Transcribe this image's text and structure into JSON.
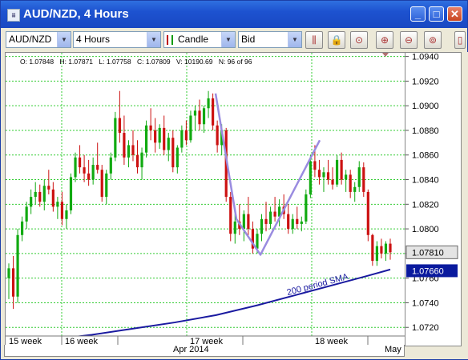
{
  "window": {
    "title": "AUD/NZD,  4 Hours",
    "minimize": "_",
    "maximize": "□",
    "close": "✕"
  },
  "toolbar": {
    "symbol": "AUD/NZD",
    "timeframe": "4 Hours",
    "chart_type": "Candle",
    "price_type": "Bid",
    "icons": [
      "bars-icon",
      "lock-icon",
      "zoom-fit-icon",
      "zoom-in-icon",
      "zoom-out-icon",
      "zoom-reset-icon"
    ]
  },
  "ohlc": {
    "open": "O: 1.07848",
    "high": "H: 1.07871",
    "low": "L: 1.07758",
    "close": "C: 1.07809",
    "volume": "V: 10190.69",
    "count": "N: 96 of 96"
  },
  "price_axis": {
    "labels": [
      "1.0940",
      "1.0920",
      "1.0900",
      "1.0880",
      "1.0860",
      "1.0840",
      "1.0820",
      "1.0800",
      "1.0780",
      "1.0760",
      "1.0740",
      "1.0720"
    ],
    "current_price": "1.07810",
    "sma_price": "1.07660"
  },
  "time_axis": {
    "weeks": [
      "15 week",
      "16 week",
      "17 week",
      "18 week"
    ],
    "months": [
      "Apr 2014",
      "May"
    ]
  },
  "annotations": {
    "sma_label": "200 period SMA"
  },
  "colors": {
    "bull": "#11aa11",
    "bear": "#cc1111",
    "grid": "#33cc33",
    "sma": "#1a1aa0",
    "pattern": "#9a8ce0",
    "sma_box": "#0a1a9e"
  },
  "chart_data": {
    "type": "candlestick",
    "title": "AUD/NZD,  4 Hours",
    "ylim": [
      1.0713,
      1.0943
    ],
    "annotation": "200 period SMA",
    "candles": [
      {
        "o": 1.076,
        "h": 1.0772,
        "l": 1.0743,
        "c": 1.0768
      },
      {
        "o": 1.0768,
        "h": 1.0778,
        "l": 1.0735,
        "c": 1.0745
      },
      {
        "o": 1.0745,
        "h": 1.08,
        "l": 1.074,
        "c": 1.0795
      },
      {
        "o": 1.0795,
        "h": 1.081,
        "l": 1.079,
        "c": 1.0806
      },
      {
        "o": 1.0806,
        "h": 1.0822,
        "l": 1.08,
        "c": 1.0818
      },
      {
        "o": 1.0818,
        "h": 1.0832,
        "l": 1.0812,
        "c": 1.0826
      },
      {
        "o": 1.0826,
        "h": 1.0838,
        "l": 1.082,
        "c": 1.083
      },
      {
        "o": 1.083,
        "h": 1.0836,
        "l": 1.0818,
        "c": 1.0822
      },
      {
        "o": 1.0822,
        "h": 1.084,
        "l": 1.0815,
        "c": 1.0835
      },
      {
        "o": 1.0835,
        "h": 1.0848,
        "l": 1.0828,
        "c": 1.0832
      },
      {
        "o": 1.0832,
        "h": 1.0838,
        "l": 1.0814,
        "c": 1.0818
      },
      {
        "o": 1.0818,
        "h": 1.0826,
        "l": 1.0808,
        "c": 1.0822
      },
      {
        "o": 1.0822,
        "h": 1.083,
        "l": 1.0803,
        "c": 1.0808
      },
      {
        "o": 1.0808,
        "h": 1.082,
        "l": 1.08,
        "c": 1.0815
      },
      {
        "o": 1.0815,
        "h": 1.0845,
        "l": 1.0812,
        "c": 1.0842
      },
      {
        "o": 1.0842,
        "h": 1.0862,
        "l": 1.0838,
        "c": 1.0858
      },
      {
        "o": 1.0858,
        "h": 1.0868,
        "l": 1.0845,
        "c": 1.085
      },
      {
        "o": 1.085,
        "h": 1.086,
        "l": 1.0838,
        "c": 1.0845
      },
      {
        "o": 1.0845,
        "h": 1.0856,
        "l": 1.0835,
        "c": 1.084
      },
      {
        "o": 1.084,
        "h": 1.0858,
        "l": 1.0836,
        "c": 1.0852
      },
      {
        "o": 1.0852,
        "h": 1.087,
        "l": 1.0845,
        "c": 1.0848
      },
      {
        "o": 1.0848,
        "h": 1.0852,
        "l": 1.0822,
        "c": 1.0826
      },
      {
        "o": 1.0826,
        "h": 1.0848,
        "l": 1.082,
        "c": 1.0845
      },
      {
        "o": 1.0845,
        "h": 1.0862,
        "l": 1.084,
        "c": 1.0858
      },
      {
        "o": 1.0858,
        "h": 1.0895,
        "l": 1.0855,
        "c": 1.089
      },
      {
        "o": 1.089,
        "h": 1.0912,
        "l": 1.087,
        "c": 1.0878
      },
      {
        "o": 1.0878,
        "h": 1.0892,
        "l": 1.0852,
        "c": 1.0858
      },
      {
        "o": 1.0858,
        "h": 1.0872,
        "l": 1.085,
        "c": 1.0868
      },
      {
        "o": 1.0868,
        "h": 1.088,
        "l": 1.0855,
        "c": 1.086
      },
      {
        "o": 1.086,
        "h": 1.0872,
        "l": 1.0845,
        "c": 1.085
      },
      {
        "o": 1.085,
        "h": 1.0866,
        "l": 1.084,
        "c": 1.0862
      },
      {
        "o": 1.0862,
        "h": 1.0888,
        "l": 1.0858,
        "c": 1.0884
      },
      {
        "o": 1.0884,
        "h": 1.0898,
        "l": 1.0872,
        "c": 1.088
      },
      {
        "o": 1.088,
        "h": 1.089,
        "l": 1.0862,
        "c": 1.087
      },
      {
        "o": 1.087,
        "h": 1.0885,
        "l": 1.0865,
        "c": 1.0882
      },
      {
        "o": 1.0882,
        "h": 1.0892,
        "l": 1.086,
        "c": 1.0864
      },
      {
        "o": 1.0864,
        "h": 1.0878,
        "l": 1.0855,
        "c": 1.0874
      },
      {
        "o": 1.0874,
        "h": 1.088,
        "l": 1.0846,
        "c": 1.085
      },
      {
        "o": 1.085,
        "h": 1.0868,
        "l": 1.0845,
        "c": 1.0866
      },
      {
        "o": 1.0866,
        "h": 1.0884,
        "l": 1.0862,
        "c": 1.088
      },
      {
        "o": 1.088,
        "h": 1.0888,
        "l": 1.0868,
        "c": 1.0872
      },
      {
        "o": 1.0872,
        "h": 1.0896,
        "l": 1.087,
        "c": 1.0892
      },
      {
        "o": 1.0892,
        "h": 1.09,
        "l": 1.088,
        "c": 1.0896
      },
      {
        "o": 1.0896,
        "h": 1.0905,
        "l": 1.088,
        "c": 1.0885
      },
      {
        "o": 1.0885,
        "h": 1.09,
        "l": 1.0878,
        "c": 1.0898
      },
      {
        "o": 1.0898,
        "h": 1.0912,
        "l": 1.089,
        "c": 1.0906
      },
      {
        "o": 1.0906,
        "h": 1.091,
        "l": 1.088,
        "c": 1.0884
      },
      {
        "o": 1.0884,
        "h": 1.0888,
        "l": 1.0862,
        "c": 1.0868
      },
      {
        "o": 1.0868,
        "h": 1.0885,
        "l": 1.086,
        "c": 1.088
      },
      {
        "o": 1.088,
        "h": 1.0882,
        "l": 1.0822,
        "c": 1.0826
      },
      {
        "o": 1.0826,
        "h": 1.083,
        "l": 1.079,
        "c": 1.0796
      },
      {
        "o": 1.0796,
        "h": 1.0812,
        "l": 1.0788,
        "c": 1.0806
      },
      {
        "o": 1.0806,
        "h": 1.082,
        "l": 1.0795,
        "c": 1.08
      },
      {
        "o": 1.08,
        "h": 1.0815,
        "l": 1.079,
        "c": 1.0812
      },
      {
        "o": 1.0812,
        "h": 1.0826,
        "l": 1.0795,
        "c": 1.08
      },
      {
        "o": 1.08,
        "h": 1.0806,
        "l": 1.078,
        "c": 1.0784
      },
      {
        "o": 1.0784,
        "h": 1.08,
        "l": 1.078,
        "c": 1.0796
      },
      {
        "o": 1.0796,
        "h": 1.0812,
        "l": 1.079,
        "c": 1.0808
      },
      {
        "o": 1.0808,
        "h": 1.0822,
        "l": 1.0798,
        "c": 1.0804
      },
      {
        "o": 1.0804,
        "h": 1.0818,
        "l": 1.08,
        "c": 1.0814
      },
      {
        "o": 1.0814,
        "h": 1.0826,
        "l": 1.0806,
        "c": 1.081
      },
      {
        "o": 1.081,
        "h": 1.0824,
        "l": 1.0802,
        "c": 1.0818
      },
      {
        "o": 1.0818,
        "h": 1.0828,
        "l": 1.0808,
        "c": 1.0812
      },
      {
        "o": 1.0812,
        "h": 1.082,
        "l": 1.0796,
        "c": 1.08
      },
      {
        "o": 1.08,
        "h": 1.0812,
        "l": 1.0796,
        "c": 1.0808
      },
      {
        "o": 1.0808,
        "h": 1.0818,
        "l": 1.08,
        "c": 1.0804
      },
      {
        "o": 1.0804,
        "h": 1.081,
        "l": 1.0798,
        "c": 1.0806
      },
      {
        "o": 1.0806,
        "h": 1.0832,
        "l": 1.0804,
        "c": 1.0828
      },
      {
        "o": 1.0828,
        "h": 1.086,
        "l": 1.0825,
        "c": 1.0855
      },
      {
        "o": 1.0855,
        "h": 1.0868,
        "l": 1.0842,
        "c": 1.0848
      },
      {
        "o": 1.0848,
        "h": 1.0856,
        "l": 1.0836,
        "c": 1.0842
      },
      {
        "o": 1.0842,
        "h": 1.085,
        "l": 1.083,
        "c": 1.0846
      },
      {
        "o": 1.0846,
        "h": 1.0856,
        "l": 1.0836,
        "c": 1.084
      },
      {
        "o": 1.084,
        "h": 1.085,
        "l": 1.0832,
        "c": 1.0836
      },
      {
        "o": 1.0836,
        "h": 1.086,
        "l": 1.0834,
        "c": 1.0856
      },
      {
        "o": 1.0856,
        "h": 1.0862,
        "l": 1.0836,
        "c": 1.084
      },
      {
        "o": 1.084,
        "h": 1.0848,
        "l": 1.083,
        "c": 1.0844
      },
      {
        "o": 1.0844,
        "h": 1.0848,
        "l": 1.0825,
        "c": 1.083
      },
      {
        "o": 1.083,
        "h": 1.0838,
        "l": 1.0822,
        "c": 1.0834
      },
      {
        "o": 1.0834,
        "h": 1.0855,
        "l": 1.083,
        "c": 1.085
      },
      {
        "o": 1.085,
        "h": 1.0854,
        "l": 1.0826,
        "c": 1.083
      },
      {
        "o": 1.083,
        "h": 1.0832,
        "l": 1.079,
        "c": 1.0795
      },
      {
        "o": 1.0795,
        "h": 1.0796,
        "l": 1.077,
        "c": 1.0774
      },
      {
        "o": 1.0774,
        "h": 1.079,
        "l": 1.077,
        "c": 1.0786
      },
      {
        "o": 1.0786,
        "h": 1.0792,
        "l": 1.0776,
        "c": 1.078
      },
      {
        "o": 1.078,
        "h": 1.079,
        "l": 1.0774,
        "c": 1.0788
      },
      {
        "o": 1.0788,
        "h": 1.0792,
        "l": 1.0775,
        "c": 1.0781
      }
    ],
    "sma": [
      [
        30,
        1.071
      ],
      [
        60,
        1.0714
      ],
      [
        90,
        1.0719
      ],
      [
        120,
        1.0724
      ],
      [
        150,
        1.073
      ],
      [
        180,
        1.0738
      ],
      [
        210,
        1.0747
      ],
      [
        240,
        1.0756
      ],
      [
        260,
        1.0762
      ],
      [
        276,
        1.0767
      ]
    ],
    "pattern": [
      [
        1.0912,
        1.088
      ],
      [
        1.0808,
        1.08
      ],
      [
        1.0782,
        1.0776
      ],
      [
        1.0876,
        1.087
      ]
    ]
  }
}
